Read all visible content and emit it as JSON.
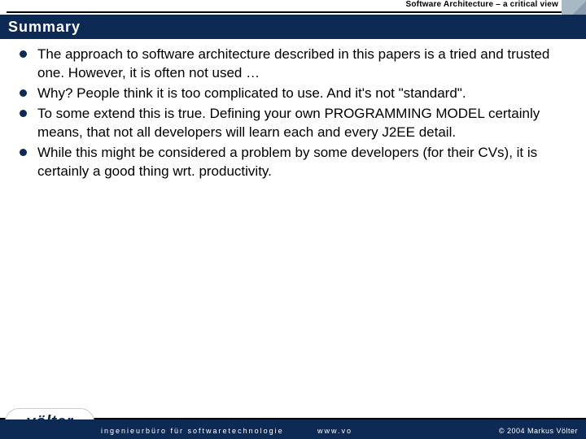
{
  "header": {
    "doc_title": "Software Architecture – a critical view",
    "slide_title": "Summary"
  },
  "bullets": [
    "The approach to software architecture described in this papers is a tried and trusted one. However, it is often not used …",
    "Why? People think it is too complicated to use. And it's not \"standard\".",
    "To some extend this is true. Defining your own PROGRAMMING MODEL certainly means, that not all developers will learn each and every J2EE detail.",
    "While this might be considered a problem by some developers (for their CVs), it is certainly a good thing wrt. productivity."
  ],
  "footer": {
    "logo_text": "völter",
    "tagline": "ingenieurbüro für softwaretechnologie",
    "url": "www.vo",
    "copyright": "© 2004  Markus Völter"
  }
}
